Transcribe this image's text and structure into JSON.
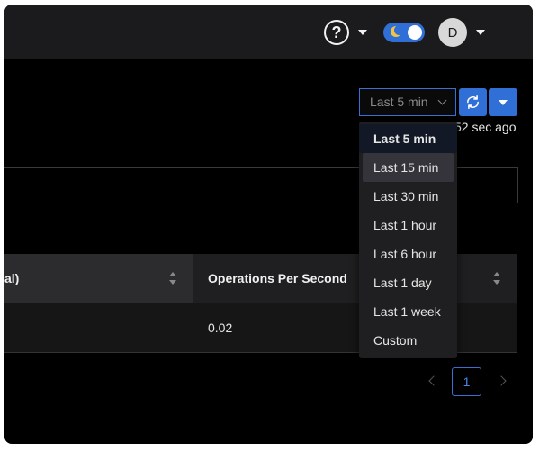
{
  "topbar": {
    "help_glyph": "?",
    "avatar_initial": "D"
  },
  "time_range": {
    "selected": "Last 5 min",
    "updated": "52 sec ago",
    "options": [
      "Last 5 min",
      "Last 15 min",
      "Last 30 min",
      "Last 1 hour",
      "Last 6 hour",
      "Last 1 day",
      "Last 1 week",
      "Custom"
    ]
  },
  "table": {
    "columns": [
      "al)",
      "Operations Per Second"
    ],
    "rows": [
      [
        "",
        "0.02"
      ]
    ]
  },
  "pagination": {
    "current_page": "1"
  },
  "colors": {
    "accent": "#2f6fd6",
    "topbar_bg": "#1b1b1d",
    "page_bg": "#000000"
  },
  "icons": [
    "help-circle-icon",
    "moon-icon",
    "refresh-icon",
    "chevron-down-icon",
    "sort-icon",
    "chevron-left-icon",
    "chevron-right-icon"
  ]
}
